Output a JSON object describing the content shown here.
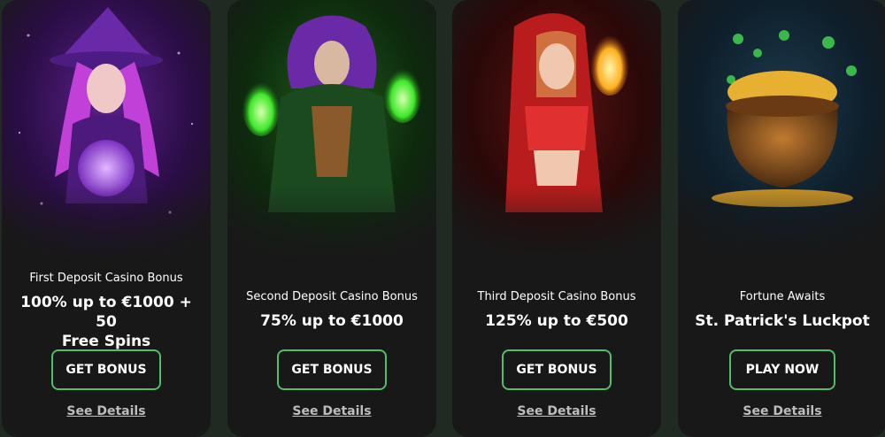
{
  "offers": [
    {
      "image": "witch-crystal-ball-illustration",
      "accent": "#8a2be2",
      "subtitle": "First Deposit Casino Bonus",
      "title_line1": "100% up to €1000 + 50",
      "title_line2": "Free Spins",
      "button_label": "GET BONUS",
      "details_label": "See Details"
    },
    {
      "image": "sorceress-green-flames-illustration",
      "accent": "#2ecc40",
      "subtitle": "Second Deposit Casino Bonus",
      "title_line1": "75% up to €1000",
      "button_label": "GET BONUS",
      "details_label": "See Details"
    },
    {
      "image": "fire-mage-illustration",
      "accent": "#d62020",
      "subtitle": "Third Deposit Casino Bonus",
      "title_line1": "125% up to €500",
      "button_label": "GET BONUS",
      "details_label": "See Details"
    },
    {
      "image": "pot-of-gold-shamrocks-illustration",
      "accent": "#2a5a7a",
      "subtitle": "Fortune Awaits",
      "title_line1": "St. Patrick's Luckpot",
      "button_label": "PLAY NOW",
      "details_label": "See Details"
    }
  ],
  "colors": {
    "page_bg": "#1e2a22",
    "card_bg": "#181818",
    "button_border": "#4fbf68",
    "details_text": "#bdbdbd"
  }
}
